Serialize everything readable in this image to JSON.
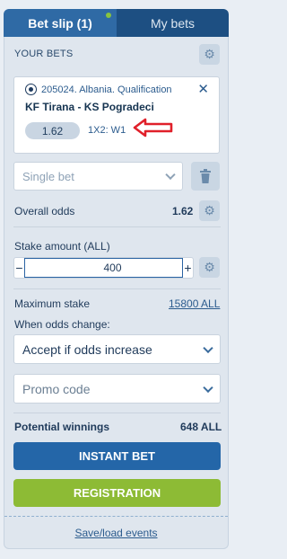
{
  "tabs": {
    "active": "Bet slip (1)",
    "inactive": "My bets"
  },
  "your_bets": {
    "heading": "YOUR BETS"
  },
  "bet": {
    "league": "205024. Albania. Qualification",
    "match": "KF Tirana - KS Pogradeci",
    "odds": "1.62",
    "market": "1X2: W1"
  },
  "bet_type": {
    "selected": "Single bet"
  },
  "overall_odds": {
    "label": "Overall odds",
    "value": "1.62"
  },
  "stake": {
    "label": "Stake amount (ALL)",
    "minus": "−",
    "plus": "+",
    "value": "400"
  },
  "maximum_stake": {
    "label": "Maximum stake",
    "value": "15800 ALL"
  },
  "odds_change": {
    "label": "When odds change:",
    "selected": "Accept if odds increase"
  },
  "promo": {
    "placeholder": "Promo code"
  },
  "potential_winnings": {
    "label": "Potential winnings",
    "value": "648 ALL"
  },
  "buttons": {
    "instant_bet": "INSTANT BET",
    "registration": "REGISTRATION"
  },
  "footer": {
    "save_load": "Save/load events"
  },
  "icons": {
    "notification_dot": "green-dot",
    "settings": "gear-icon",
    "sport": "soccer-ball-icon",
    "close": "close-icon",
    "annotation": "red-arrow-icon",
    "dropdown": "chevron-down-icon",
    "delete": "trash-icon"
  },
  "colors": {
    "tab_active": "#2f6aa5",
    "tab_inactive": "#1d4f82",
    "instant_bet": "#2466a8",
    "registration": "#8dbb35",
    "notification_dot": "#88c33f",
    "annotation_arrow": "#e0202a"
  }
}
